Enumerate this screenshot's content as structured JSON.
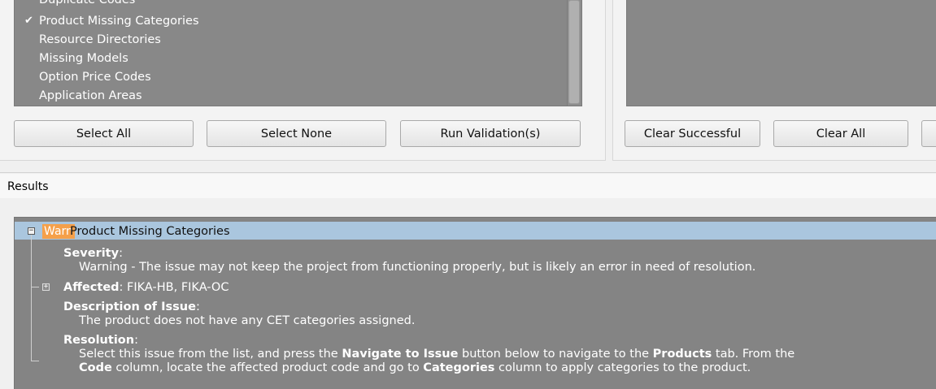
{
  "validations": {
    "items": [
      {
        "label": "Duplicate Codes",
        "checked": false
      },
      {
        "label": "Product Missing Categories",
        "checked": true
      },
      {
        "label": "Resource Directories",
        "checked": false
      },
      {
        "label": "Missing Models",
        "checked": false
      },
      {
        "label": "Option Price Codes",
        "checked": false
      },
      {
        "label": "Application Areas",
        "checked": false
      }
    ],
    "check_glyph": "✔",
    "buttons": {
      "select_all": "Select All",
      "select_none": "Select None",
      "run": "Run Validation(s)"
    }
  },
  "output": {
    "buttons": {
      "clear_successful": "Clear Successful",
      "clear_all": "Clear All"
    }
  },
  "results": {
    "label": "Results",
    "issue": {
      "badge": "Warn",
      "title": "Product Missing Categories",
      "severity_label": "Severity",
      "severity_text": "Warning - The issue may not keep the project from functioning properly, but is likely an error in need of resolution.",
      "affected_label": "Affected",
      "affected_value": "FIKA-HB, FIKA-OC",
      "description_label": "Description of Issue",
      "description_text": "The product does not have any CET categories assigned.",
      "resolution_label": "Resolution",
      "resolution_line1": {
        "t1": "Select this issue from the list, and press the ",
        "b1": "Navigate to Issue",
        "t2": " button below to navigate to the ",
        "b2": "Products",
        "t3": " tab. From the"
      },
      "resolution_line2": {
        "b1": "Code",
        "t1": " column, locate the affected product code and go to ",
        "b2": "Categories",
        "t2": " column to apply categories to the product."
      }
    }
  },
  "colors": {
    "panel_gray": "#888888",
    "selection_blue": "#aac6de",
    "warn_orange": "#f5a04a"
  }
}
